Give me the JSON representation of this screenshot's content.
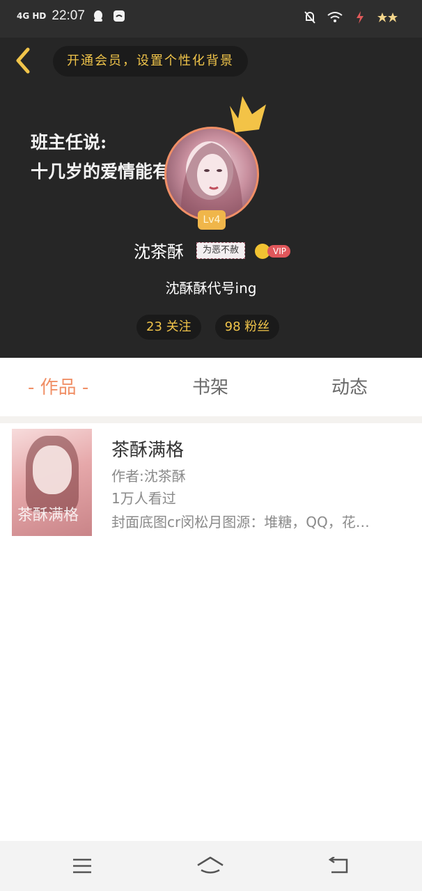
{
  "status_bar": {
    "signal": "4G HD",
    "time": "22:07"
  },
  "header": {
    "background_text_line1": "班主任说:",
    "background_text_line2": "十几岁的爱情能有多",
    "vip_banner": "开通会员，设置个性化背景",
    "level": "Lv4",
    "username": "沈茶酥",
    "name_tag": "为恶不赦",
    "vip_label": "VIP",
    "signature": "沈酥酥代号ing",
    "following": "23 关注",
    "followers": "98 粉丝"
  },
  "tabs": [
    {
      "label": "- 作品 -",
      "active": true
    },
    {
      "label": "书架",
      "active": false
    },
    {
      "label": "动态",
      "active": false
    }
  ],
  "works": [
    {
      "cover_text": "茶酥满格",
      "title": "茶酥满格",
      "author": "作者:沈茶酥",
      "views": "1万人看过",
      "description": "封面底图cr闵松月图源：堆糖，QQ，花…"
    }
  ],
  "colors": {
    "accent": "#f08f66",
    "gold": "#f0c44a",
    "header_bg": "#262626"
  }
}
